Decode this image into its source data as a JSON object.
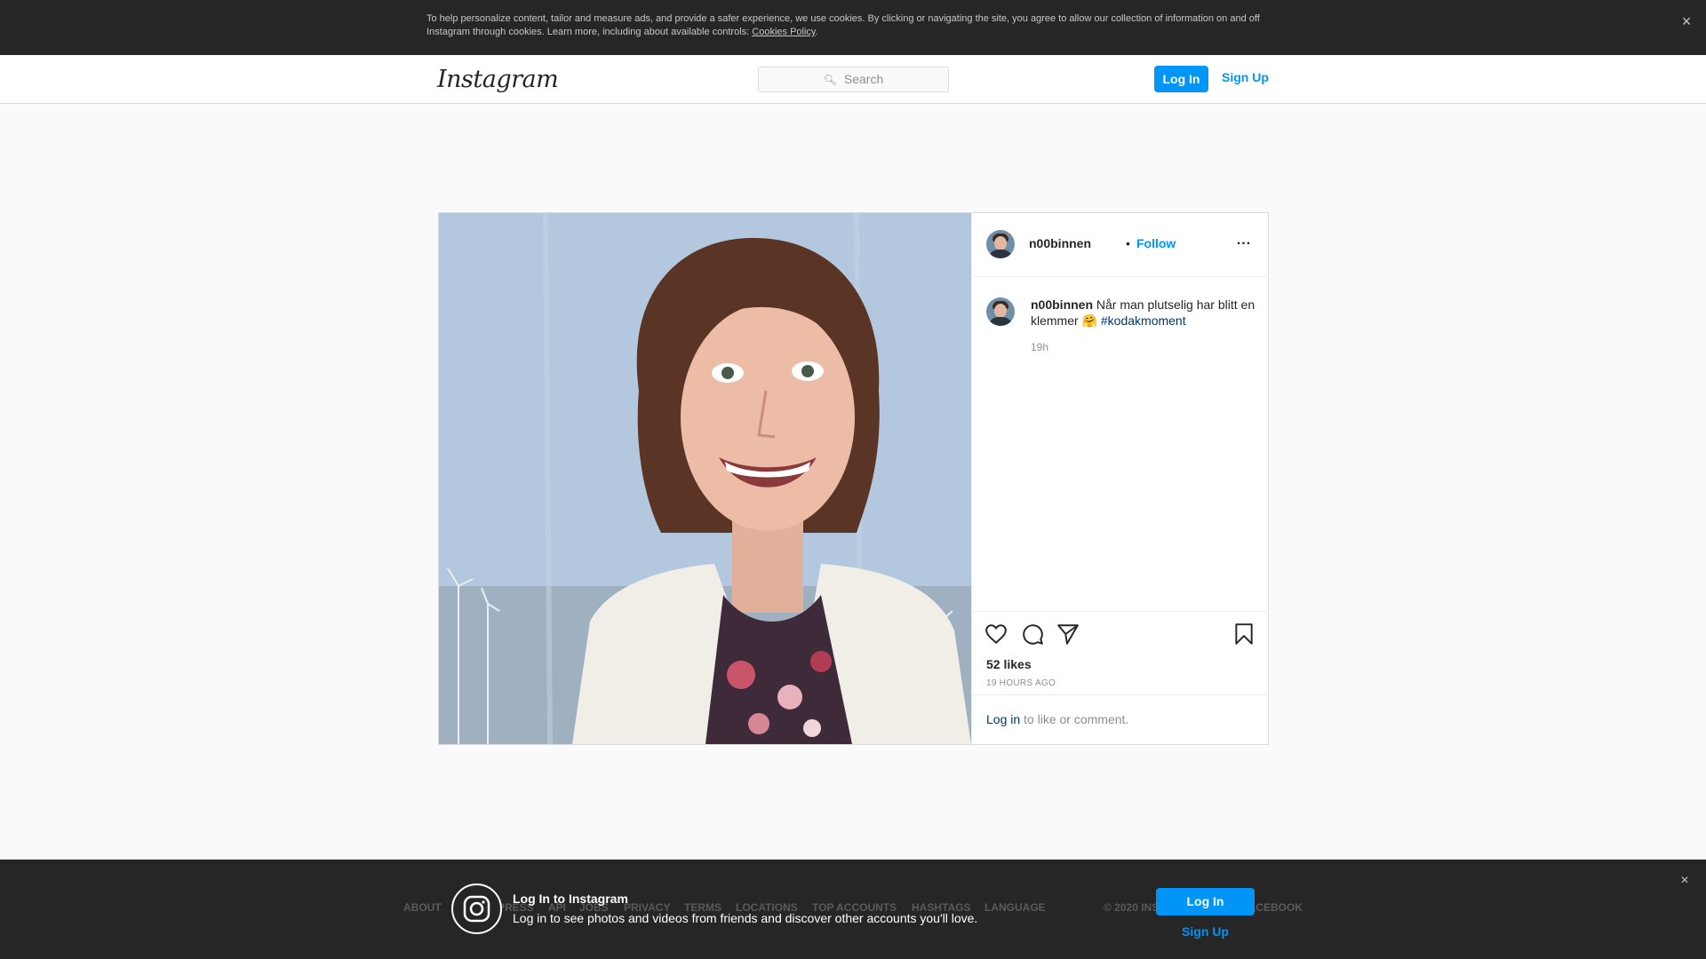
{
  "cookie_banner": {
    "text": "To help personalize content, tailor and measure ads, and provide a safer experience, we use cookies. By clicking or navigating the site, you agree to allow our collection of information on and off Instagram through cookies. Learn more, including about available controls:",
    "policy_link": "Cookies Policy",
    "close": "×"
  },
  "nav": {
    "logo": "Instagram",
    "search_placeholder": "Search",
    "search_icon": "search-icon",
    "login": "Log In",
    "signup": "Sign Up"
  },
  "post": {
    "username": "n00binnen",
    "separator": "•",
    "follow": "Follow",
    "more": "...",
    "caption_user": "n00binnen",
    "caption_text": "Når man plutselig har blitt en klemmer ",
    "caption_emoji": "🤗",
    "hashtag": "#kodakmoment",
    "caption_age": "19h",
    "likes": "52 likes",
    "posted": "19 HOURS AGO",
    "login_link": "Log in",
    "login_rest": " to like or comment.",
    "icons": [
      "heart-icon",
      "comment-icon",
      "share-icon",
      "bookmark-icon"
    ]
  },
  "footer": {
    "links": [
      "ABOUT",
      "PRESS",
      "API",
      "JOBS",
      "PRIVACY",
      "TERMS",
      "LOCATIONS",
      "TOP ACCOUNTS",
      "HASHTAGS",
      "LANGUAGE"
    ],
    "copyright": "© 2020 INSTAGRAM FROM FACEBOOK"
  },
  "login_prompt": {
    "title": "Log In to Instagram",
    "subtitle": "Log in to see photos and videos from friends and discover other accounts you'll love.",
    "login": "Log In",
    "signup": "Sign Up",
    "close": "×"
  }
}
